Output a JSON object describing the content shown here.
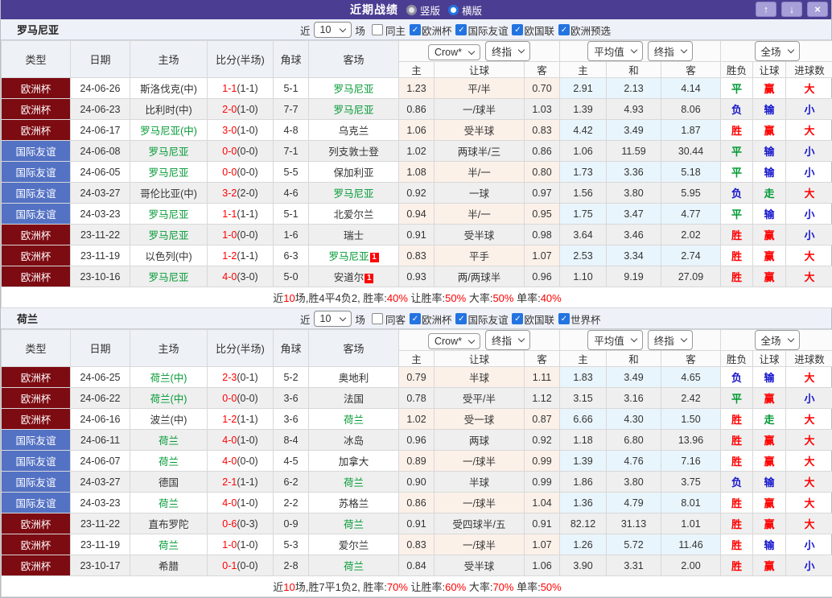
{
  "titlebar": {
    "title": "近期战绩",
    "vertical_label": "竖版",
    "horizontal_label": "横版",
    "up_button": "↑",
    "down_button": "↓",
    "close_button": "×"
  },
  "colors": {
    "titlebar": "#4b3e92",
    "badge_cup": "#7d0b12",
    "badge_friendly": "#5472c4",
    "win_red": "#ff0000",
    "draw_green": "#009933",
    "lose_blue": "#1515cc"
  },
  "sections": [
    {
      "team": "罗马尼亚",
      "filter": {
        "near": "近",
        "count": "10",
        "unit": "场",
        "same_label": "同主",
        "same_checked": false,
        "leagues": [
          {
            "label": "欧洲杯",
            "checked": true
          },
          {
            "label": "国际友谊",
            "checked": true
          },
          {
            "label": "欧国联",
            "checked": true
          },
          {
            "label": "欧洲预选",
            "checked": true
          }
        ]
      },
      "header": {
        "main": [
          "类型",
          "日期",
          "主场",
          "比分(半场)",
          "角球",
          "客场"
        ],
        "g1_dd": [
          "Crow*",
          "终指"
        ],
        "g2_dd": [
          "平均值",
          "终指"
        ],
        "g3_dd": "全场",
        "sub": [
          "主",
          "让球",
          "客",
          "主",
          "和",
          "客",
          "胜负",
          "让球",
          "进球数"
        ]
      },
      "rows": [
        {
          "type": "欧洲杯",
          "tk": "cup",
          "date": "24-06-26",
          "home": "斯洛伐克(中)",
          "hg": false,
          "score": "1-1",
          "half": "(1-1)",
          "corner": "5-1",
          "away": "罗马尼亚",
          "ag": true,
          "ab": "",
          "o": [
            "1.23",
            "平/半",
            "0.70",
            "2.91",
            "2.13",
            "4.14"
          ],
          "r": [
            [
              "平",
              "g"
            ],
            [
              "赢",
              "r"
            ],
            [
              "大",
              "r"
            ]
          ]
        },
        {
          "type": "欧洲杯",
          "tk": "cup",
          "date": "24-06-23",
          "home": "比利时(中)",
          "hg": false,
          "score": "2-0",
          "half": "(1-0)",
          "corner": "7-7",
          "away": "罗马尼亚",
          "ag": true,
          "ab": "",
          "o": [
            "0.86",
            "一/球半",
            "1.03",
            "1.39",
            "4.93",
            "8.06"
          ],
          "r": [
            [
              "负",
              "b"
            ],
            [
              "输",
              "b"
            ],
            [
              "小",
              "b"
            ]
          ]
        },
        {
          "type": "欧洲杯",
          "tk": "cup",
          "date": "24-06-17",
          "home": "罗马尼亚(中)",
          "hg": true,
          "score": "3-0",
          "half": "(1-0)",
          "corner": "4-8",
          "away": "乌克兰",
          "ag": false,
          "ab": "",
          "o": [
            "1.06",
            "受半球",
            "0.83",
            "4.42",
            "3.49",
            "1.87"
          ],
          "r": [
            [
              "胜",
              "r"
            ],
            [
              "赢",
              "r"
            ],
            [
              "大",
              "r"
            ]
          ]
        },
        {
          "type": "国际友谊",
          "tk": "fr",
          "date": "24-06-08",
          "home": "罗马尼亚",
          "hg": true,
          "score": "0-0",
          "half": "(0-0)",
          "corner": "7-1",
          "away": "列支敦士登",
          "ag": false,
          "ab": "",
          "o": [
            "1.02",
            "两球半/三",
            "0.86",
            "1.06",
            "11.59",
            "30.44"
          ],
          "r": [
            [
              "平",
              "g"
            ],
            [
              "输",
              "b"
            ],
            [
              "小",
              "b"
            ]
          ]
        },
        {
          "type": "国际友谊",
          "tk": "fr",
          "date": "24-06-05",
          "home": "罗马尼亚",
          "hg": true,
          "score": "0-0",
          "half": "(0-0)",
          "corner": "5-5",
          "away": "保加利亚",
          "ag": false,
          "ab": "",
          "o": [
            "1.08",
            "半/一",
            "0.80",
            "1.73",
            "3.36",
            "5.18"
          ],
          "r": [
            [
              "平",
              "g"
            ],
            [
              "输",
              "b"
            ],
            [
              "小",
              "b"
            ]
          ]
        },
        {
          "type": "国际友谊",
          "tk": "fr",
          "date": "24-03-27",
          "home": "哥伦比亚(中)",
          "hg": false,
          "score": "3-2",
          "half": "(2-0)",
          "corner": "4-6",
          "away": "罗马尼亚",
          "ag": true,
          "ab": "",
          "o": [
            "0.92",
            "一球",
            "0.97",
            "1.56",
            "3.80",
            "5.95"
          ],
          "r": [
            [
              "负",
              "b"
            ],
            [
              "走",
              "g"
            ],
            [
              "大",
              "r"
            ]
          ]
        },
        {
          "type": "国际友谊",
          "tk": "fr",
          "date": "24-03-23",
          "home": "罗马尼亚",
          "hg": true,
          "score": "1-1",
          "half": "(1-1)",
          "corner": "5-1",
          "away": "北爱尔兰",
          "ag": false,
          "ab": "",
          "o": [
            "0.94",
            "半/一",
            "0.95",
            "1.75",
            "3.47",
            "4.77"
          ],
          "r": [
            [
              "平",
              "g"
            ],
            [
              "输",
              "b"
            ],
            [
              "小",
              "b"
            ]
          ]
        },
        {
          "type": "欧洲杯",
          "tk": "cup",
          "date": "23-11-22",
          "home": "罗马尼亚",
          "hg": true,
          "score": "1-0",
          "half": "(0-0)",
          "corner": "1-6",
          "away": "瑞士",
          "ag": false,
          "ab": "",
          "o": [
            "0.91",
            "受半球",
            "0.98",
            "3.64",
            "3.46",
            "2.02"
          ],
          "r": [
            [
              "胜",
              "r"
            ],
            [
              "赢",
              "r"
            ],
            [
              "小",
              "b"
            ]
          ]
        },
        {
          "type": "欧洲杯",
          "tk": "cup",
          "date": "23-11-19",
          "home": "以色列(中)",
          "hg": false,
          "score": "1-2",
          "half": "(1-1)",
          "corner": "6-3",
          "away": "罗马尼亚",
          "ag": true,
          "ab": "1",
          "o": [
            "0.83",
            "平手",
            "1.07",
            "2.53",
            "3.34",
            "2.74"
          ],
          "r": [
            [
              "胜",
              "r"
            ],
            [
              "赢",
              "r"
            ],
            [
              "大",
              "r"
            ]
          ]
        },
        {
          "type": "欧洲杯",
          "tk": "cup",
          "date": "23-10-16",
          "home": "罗马尼亚",
          "hg": true,
          "score": "4-0",
          "half": "(3-0)",
          "corner": "5-0",
          "away": "安道尔",
          "ag": false,
          "ab": "1",
          "o": [
            "0.93",
            "两/两球半",
            "0.96",
            "1.10",
            "9.19",
            "27.09"
          ],
          "r": [
            [
              "胜",
              "r"
            ],
            [
              "赢",
              "r"
            ],
            [
              "大",
              "r"
            ]
          ]
        }
      ],
      "summary": [
        {
          "t": "近",
          "red": false
        },
        {
          "t": "10",
          "red": true
        },
        {
          "t": "场,胜4平4负2, 胜率:",
          "red": false
        },
        {
          "t": "40%",
          "red": true
        },
        {
          "t": " 让胜率:",
          "red": false
        },
        {
          "t": "50%",
          "red": true
        },
        {
          "t": " 大率:",
          "red": false
        },
        {
          "t": "50%",
          "red": true
        },
        {
          "t": " 单率:",
          "red": false
        },
        {
          "t": "40%",
          "red": true
        }
      ]
    },
    {
      "team": "荷兰",
      "filter": {
        "near": "近",
        "count": "10",
        "unit": "场",
        "same_label": "同客",
        "same_checked": false,
        "leagues": [
          {
            "label": "欧洲杯",
            "checked": true
          },
          {
            "label": "国际友谊",
            "checked": true
          },
          {
            "label": "欧国联",
            "checked": true
          },
          {
            "label": "世界杯",
            "checked": true
          }
        ]
      },
      "header": {
        "main": [
          "类型",
          "日期",
          "主场",
          "比分(半场)",
          "角球",
          "客场"
        ],
        "g1_dd": [
          "Crow*",
          "终指"
        ],
        "g2_dd": [
          "平均值",
          "终指"
        ],
        "g3_dd": "全场",
        "sub": [
          "主",
          "让球",
          "客",
          "主",
          "和",
          "客",
          "胜负",
          "让球",
          "进球数"
        ]
      },
      "rows": [
        {
          "type": "欧洲杯",
          "tk": "cup",
          "date": "24-06-25",
          "home": "荷兰(中)",
          "hg": true,
          "score": "2-3",
          "half": "(0-1)",
          "corner": "5-2",
          "away": "奥地利",
          "ag": false,
          "ab": "",
          "o": [
            "0.79",
            "半球",
            "1.11",
            "1.83",
            "3.49",
            "4.65"
          ],
          "r": [
            [
              "负",
              "b"
            ],
            [
              "输",
              "b"
            ],
            [
              "大",
              "r"
            ]
          ]
        },
        {
          "type": "欧洲杯",
          "tk": "cup",
          "date": "24-06-22",
          "home": "荷兰(中)",
          "hg": true,
          "score": "0-0",
          "half": "(0-0)",
          "corner": "3-6",
          "away": "法国",
          "ag": false,
          "ab": "",
          "o": [
            "0.78",
            "受平/半",
            "1.12",
            "3.15",
            "3.16",
            "2.42"
          ],
          "r": [
            [
              "平",
              "g"
            ],
            [
              "赢",
              "r"
            ],
            [
              "小",
              "b"
            ]
          ]
        },
        {
          "type": "欧洲杯",
          "tk": "cup",
          "date": "24-06-16",
          "home": "波兰(中)",
          "hg": false,
          "score": "1-2",
          "half": "(1-1)",
          "corner": "3-6",
          "away": "荷兰",
          "ag": true,
          "ab": "",
          "o": [
            "1.02",
            "受一球",
            "0.87",
            "6.66",
            "4.30",
            "1.50"
          ],
          "r": [
            [
              "胜",
              "r"
            ],
            [
              "走",
              "g"
            ],
            [
              "大",
              "r"
            ]
          ]
        },
        {
          "type": "国际友谊",
          "tk": "fr",
          "date": "24-06-11",
          "home": "荷兰",
          "hg": true,
          "score": "4-0",
          "half": "(1-0)",
          "corner": "8-4",
          "away": "冰岛",
          "ag": false,
          "ab": "",
          "o": [
            "0.96",
            "两球",
            "0.92",
            "1.18",
            "6.80",
            "13.96"
          ],
          "r": [
            [
              "胜",
              "r"
            ],
            [
              "赢",
              "r"
            ],
            [
              "大",
              "r"
            ]
          ]
        },
        {
          "type": "国际友谊",
          "tk": "fr",
          "date": "24-06-07",
          "home": "荷兰",
          "hg": true,
          "score": "4-0",
          "half": "(0-0)",
          "corner": "4-5",
          "away": "加拿大",
          "ag": false,
          "ab": "",
          "o": [
            "0.89",
            "一/球半",
            "0.99",
            "1.39",
            "4.76",
            "7.16"
          ],
          "r": [
            [
              "胜",
              "r"
            ],
            [
              "赢",
              "r"
            ],
            [
              "大",
              "r"
            ]
          ]
        },
        {
          "type": "国际友谊",
          "tk": "fr",
          "date": "24-03-27",
          "home": "德国",
          "hg": false,
          "score": "2-1",
          "half": "(1-1)",
          "corner": "6-2",
          "away": "荷兰",
          "ag": true,
          "ab": "",
          "o": [
            "0.90",
            "半球",
            "0.99",
            "1.86",
            "3.80",
            "3.75"
          ],
          "r": [
            [
              "负",
              "b"
            ],
            [
              "输",
              "b"
            ],
            [
              "大",
              "r"
            ]
          ]
        },
        {
          "type": "国际友谊",
          "tk": "fr",
          "date": "24-03-23",
          "home": "荷兰",
          "hg": true,
          "score": "4-0",
          "half": "(1-0)",
          "corner": "2-2",
          "away": "苏格兰",
          "ag": false,
          "ab": "",
          "o": [
            "0.86",
            "一/球半",
            "1.04",
            "1.36",
            "4.79",
            "8.01"
          ],
          "r": [
            [
              "胜",
              "r"
            ],
            [
              "赢",
              "r"
            ],
            [
              "大",
              "r"
            ]
          ]
        },
        {
          "type": "欧洲杯",
          "tk": "cup",
          "date": "23-11-22",
          "home": "直布罗陀",
          "hg": false,
          "score": "0-6",
          "half": "(0-3)",
          "corner": "0-9",
          "away": "荷兰",
          "ag": true,
          "ab": "",
          "o": [
            "0.91",
            "受四球半/五",
            "0.91",
            "82.12",
            "31.13",
            "1.01"
          ],
          "r": [
            [
              "胜",
              "r"
            ],
            [
              "赢",
              "r"
            ],
            [
              "大",
              "r"
            ]
          ]
        },
        {
          "type": "欧洲杯",
          "tk": "cup",
          "date": "23-11-19",
          "home": "荷兰",
          "hg": true,
          "score": "1-0",
          "half": "(1-0)",
          "corner": "5-3",
          "away": "爱尔兰",
          "ag": false,
          "ab": "",
          "o": [
            "0.83",
            "一/球半",
            "1.07",
            "1.26",
            "5.72",
            "11.46"
          ],
          "r": [
            [
              "胜",
              "r"
            ],
            [
              "输",
              "b"
            ],
            [
              "小",
              "b"
            ]
          ]
        },
        {
          "type": "欧洲杯",
          "tk": "cup",
          "date": "23-10-17",
          "home": "希腊",
          "hg": false,
          "score": "0-1",
          "half": "(0-0)",
          "corner": "2-8",
          "away": "荷兰",
          "ag": true,
          "ab": "",
          "o": [
            "0.84",
            "受半球",
            "1.06",
            "3.90",
            "3.31",
            "2.00"
          ],
          "r": [
            [
              "胜",
              "r"
            ],
            [
              "赢",
              "r"
            ],
            [
              "小",
              "b"
            ]
          ]
        }
      ],
      "summary": [
        {
          "t": "近",
          "red": false
        },
        {
          "t": "10",
          "red": true
        },
        {
          "t": "场,胜7平1负2, 胜率:",
          "red": false
        },
        {
          "t": "70%",
          "red": true
        },
        {
          "t": " 让胜率:",
          "red": false
        },
        {
          "t": "60%",
          "red": true
        },
        {
          "t": " 大率:",
          "red": false
        },
        {
          "t": "70%",
          "red": true
        },
        {
          "t": " 单率:",
          "red": false
        },
        {
          "t": "50%",
          "red": true
        }
      ]
    }
  ]
}
